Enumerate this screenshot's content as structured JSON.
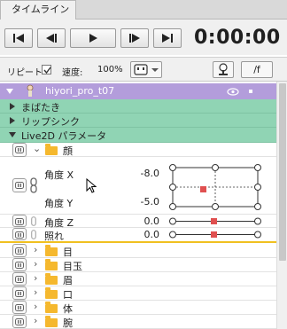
{
  "tab": {
    "label": "タイムライン"
  },
  "transport": {
    "timecode": "0:00:00"
  },
  "options": {
    "repeat_label": "リピート",
    "repeat_checked": true,
    "speed_label": "速度:",
    "speed_value": "100%",
    "fx_button": "/f"
  },
  "model": {
    "name": "hiyori_pro_t07"
  },
  "groups": {
    "blink": "まばたき",
    "lipsync": "リップシンク",
    "params": "Live2D パラメータ"
  },
  "face_folder": "顔",
  "params": {
    "angle_x": {
      "label": "角度 X",
      "value": "-8.0"
    },
    "angle_y": {
      "label": "角度 Y",
      "value": "-5.0"
    },
    "angle_z": {
      "label": "角度 Z",
      "value": "0.0"
    },
    "blush": {
      "label": "照れ",
      "value": "0.0"
    }
  },
  "folders": [
    "目",
    "目玉",
    "眉",
    "口",
    "体",
    "腕"
  ],
  "colors": {
    "model_row": "#b39ddb",
    "group_row": "#90d4b4",
    "folder": "#f5b82e",
    "key_marker": "#e05050",
    "current_line": "#f0c020"
  }
}
